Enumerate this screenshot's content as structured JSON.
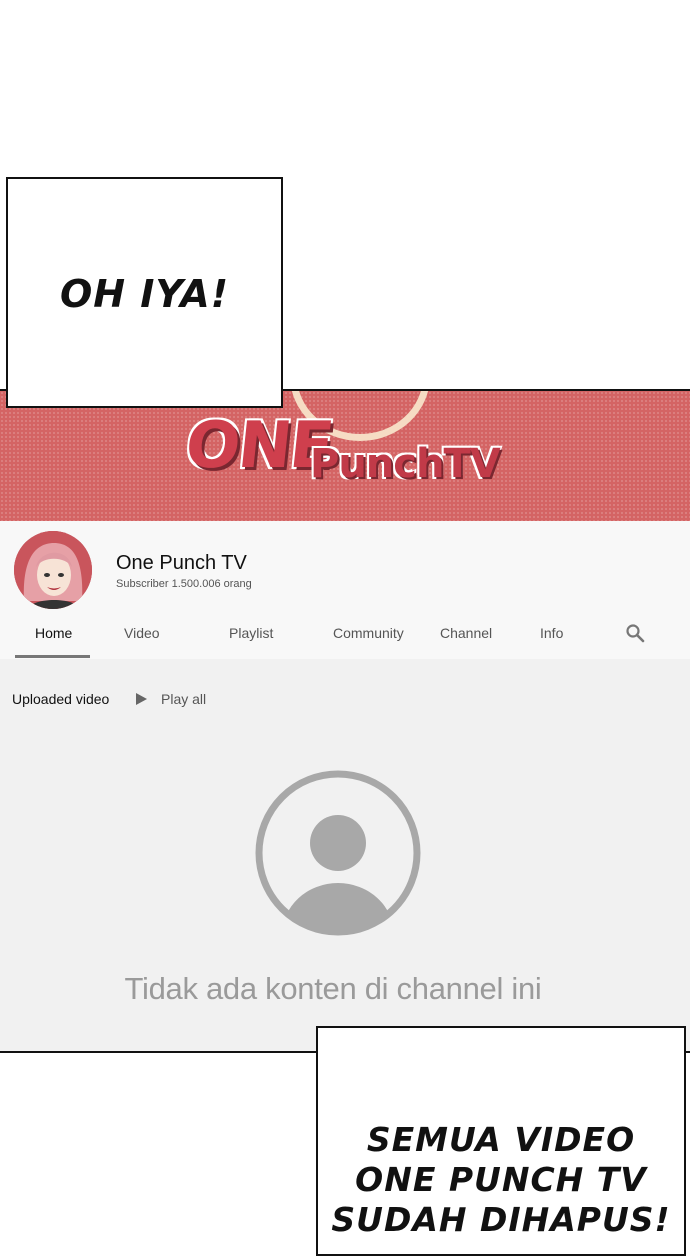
{
  "bubbles": {
    "top": "OH IYA!",
    "bottom_lines": [
      "SEMUA VIDEO",
      "ONE PUNCH TV",
      "SUDAH DIHAPUS!"
    ]
  },
  "banner": {
    "logo_one": "ONE",
    "logo_punch": "PunchTV",
    "colors": {
      "background": "#d46464",
      "logo": "#cf3f4d"
    }
  },
  "channel": {
    "name": "One Punch TV",
    "subscribers": "Subscriber 1.500.006 orang"
  },
  "tabs": [
    "Home",
    "Video",
    "Playlist",
    "Community",
    "Channel",
    "Info"
  ],
  "active_tab": "Home",
  "section": {
    "uploaded": "Uploaded video",
    "play_all": "Play all"
  },
  "empty_state": {
    "icon": "user-placeholder-icon",
    "text": "Tidak ada konten di channel ini"
  }
}
